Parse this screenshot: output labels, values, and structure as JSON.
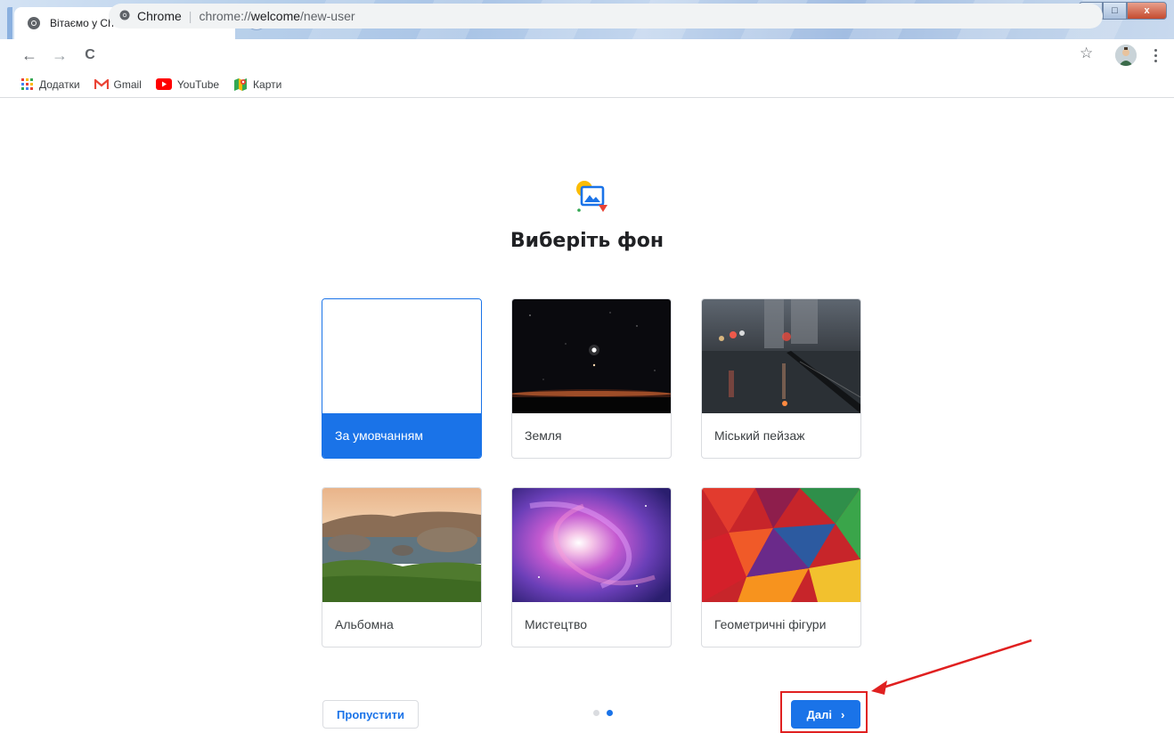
{
  "tab": {
    "title": "Вітаємо у Chrome!",
    "close": "×",
    "new_tab": "+"
  },
  "window": {
    "minimize": "–",
    "maximize": "□",
    "close": "x"
  },
  "toolbar": {
    "back": "←",
    "forward": "→",
    "reload": "C",
    "site_label": "Chrome",
    "separator": "|",
    "url_scheme": "chrome://",
    "url_host": "welcome",
    "url_path": "/new-user",
    "star": "☆"
  },
  "bookmarks": [
    {
      "label": "Додатки",
      "icon": "apps-grid-icon"
    },
    {
      "label": "Gmail",
      "icon": "gmail-icon"
    },
    {
      "label": "YouTube",
      "icon": "youtube-icon"
    },
    {
      "label": "Карти",
      "icon": "maps-icon"
    }
  ],
  "page": {
    "title": "Виберіть фон",
    "cards": [
      {
        "label": "За умовчанням",
        "selected": true
      },
      {
        "label": "Земля",
        "selected": false
      },
      {
        "label": "Міський пейзаж",
        "selected": false
      },
      {
        "label": "Альбомна",
        "selected": false
      },
      {
        "label": "Мистецтво",
        "selected": false
      },
      {
        "label": "Геометричні фігури",
        "selected": false
      }
    ],
    "skip_label": "Пропустити",
    "next_label": "Далі",
    "next_chevron": "›",
    "step_total": 2,
    "step_current": 2
  },
  "colors": {
    "accent": "#1a73e8",
    "annotation": "#e02020"
  }
}
